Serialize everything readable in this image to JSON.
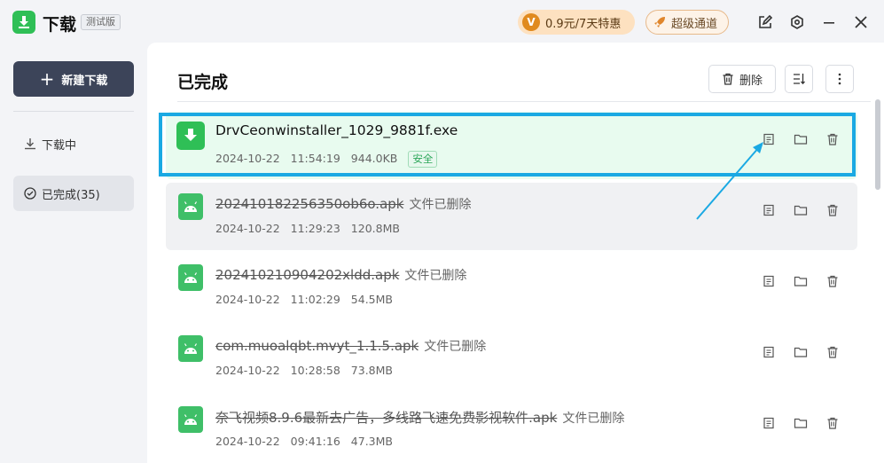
{
  "app": {
    "title": "下载",
    "badge": "测试版",
    "vip_offer": "0.9元/7天特惠",
    "vip_coin": "V",
    "super_channel": "超级通道"
  },
  "sidebar": {
    "new_download": "新建下载",
    "items": [
      {
        "label": "下载中"
      },
      {
        "label": "已完成(35)"
      }
    ]
  },
  "main": {
    "title": "已完成",
    "delete_label": "删除"
  },
  "rows": [
    {
      "name": "DrvCeonwinstaller_1029_9881f.exe",
      "status": "",
      "date": "2024-10-22",
      "time": "11:54:19",
      "size": "944.0KB",
      "badge": "安全"
    },
    {
      "name": "202410182256350ob6o.apk",
      "status": "文件已删除",
      "date": "2024-10-22",
      "time": "11:29:23",
      "size": "120.8MB"
    },
    {
      "name": "202410210904202xldd.apk",
      "status": "文件已删除",
      "date": "2024-10-22",
      "time": "11:02:29",
      "size": "54.5MB"
    },
    {
      "name": "com.muoalqbt.mvyt_1.1.5.apk",
      "status": "文件已删除",
      "date": "2024-10-22",
      "time": "10:28:58",
      "size": "73.8MB"
    },
    {
      "name": "奈飞视频8.9.6最新去广告，多线路飞速免费影视软件.apk",
      "status": "文件已删除",
      "date": "2024-10-22",
      "time": "09:41:16",
      "size": "47.3MB"
    }
  ],
  "colors": {
    "accent_green": "#2fbf56",
    "highlight": "#1aa9e3",
    "sidebar_button": "#3c4459"
  }
}
